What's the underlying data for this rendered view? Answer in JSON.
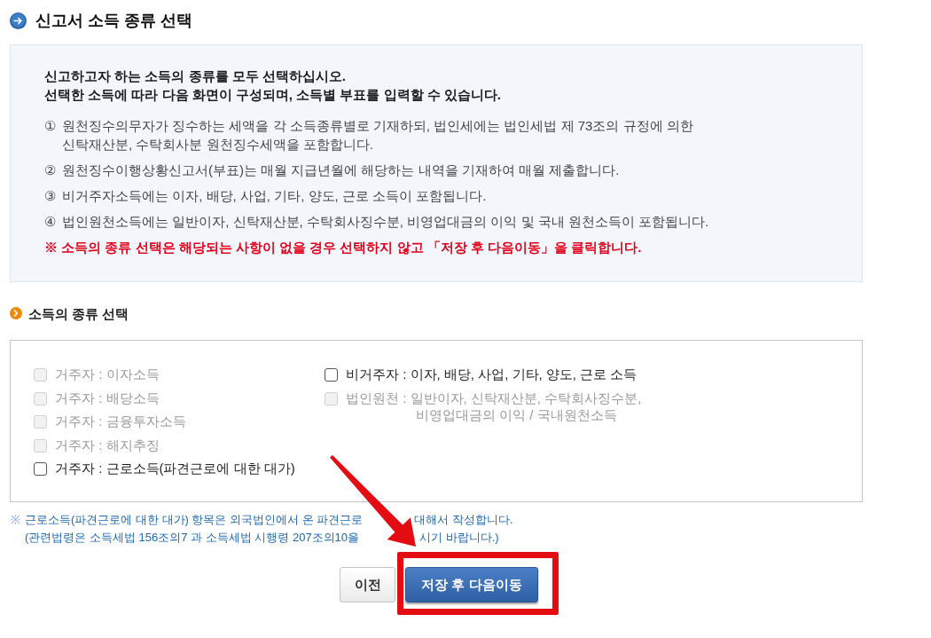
{
  "header": {
    "title": "신고서 소득 종류 선택"
  },
  "guide": {
    "intro": [
      "신고하고자 하는 소득의 종류를 모두 선택하십시오.",
      "선택한 소득에 따라 다음 화면이 구성되며, 소득별 부표를 입력할 수 있습니다."
    ],
    "items": [
      {
        "number": "①",
        "lines": [
          "원천징수의무자가 징수하는 세액을 각 소득종류별로 기재하되, 법인세에는 법인세법 제 73조의 규정에 의한",
          "신탁재산분, 수탁회사분 원천징수세액을 포함합니다."
        ]
      },
      {
        "number": "②",
        "lines": [
          "원천징수이행상황신고서(부표)는 매월 지급년월에 해당하는 내역을 기재하여 매월 제출합니다."
        ]
      },
      {
        "number": "③",
        "lines": [
          "비거주자소득에는 이자, 배당, 사업, 기타, 양도, 근로 소득이 포함됩니다."
        ]
      },
      {
        "number": "④",
        "lines": [
          "법인원천소득에는 일반이자, 신탁재산분, 수탁회사징수분, 비영업대금의 이익 및 국내 원천소득이 포함됩니다."
        ]
      }
    ],
    "warning": "※ 소득의 종류 선택은 해당되는 사항이 없을 경우 선택하지 않고 「저장 후 다음이동」을 클릭합니다."
  },
  "income_types": {
    "title": "소득의 종류 선택",
    "columns": [
      {
        "options": [
          {
            "lines": [
              "거주자 : 이자소득"
            ],
            "checked": false,
            "disabled": true
          },
          {
            "lines": [
              "거주자 : 배당소득"
            ],
            "checked": false,
            "disabled": true
          },
          {
            "lines": [
              "거주자 : 금융투자소득"
            ],
            "checked": false,
            "disabled": true
          },
          {
            "lines": [
              "거주자 : 해지추징"
            ],
            "checked": false,
            "disabled": true
          },
          {
            "lines": [
              "거주자 : 근로소득(파견근로에 대한 대가)"
            ],
            "checked": false,
            "disabled": false
          }
        ]
      },
      {
        "options": [
          {
            "lines": [
              "비거주자 : 이자, 배당, 사업, 기타, 양도, 근로 소득"
            ],
            "checked": false,
            "disabled": false
          },
          {
            "lines": [
              "법인원천 : 일반이자, 신탁재산분, 수탁회사징수분,",
              "비영업대금의 이익 / 국내원천소득"
            ],
            "checked": false,
            "disabled": true
          }
        ]
      }
    ]
  },
  "note": {
    "mark": "※",
    "lines": [
      [
        "근로소득(파견근로에 대한 대가) 항목은 외국법인에서 온 파견근로",
        "대해서 작성합니다."
      ],
      [
        "(관련법령은 소득세법 156조의7 과 소득세법 시행령 207조의10을",
        "시기 바랍니다.)"
      ]
    ]
  },
  "buttons": [
    {
      "label": "이전",
      "kind": "secondary",
      "highlighted": false
    },
    {
      "label": "저장 후 다음이동",
      "kind": "primary",
      "highlighted": true
    }
  ]
}
